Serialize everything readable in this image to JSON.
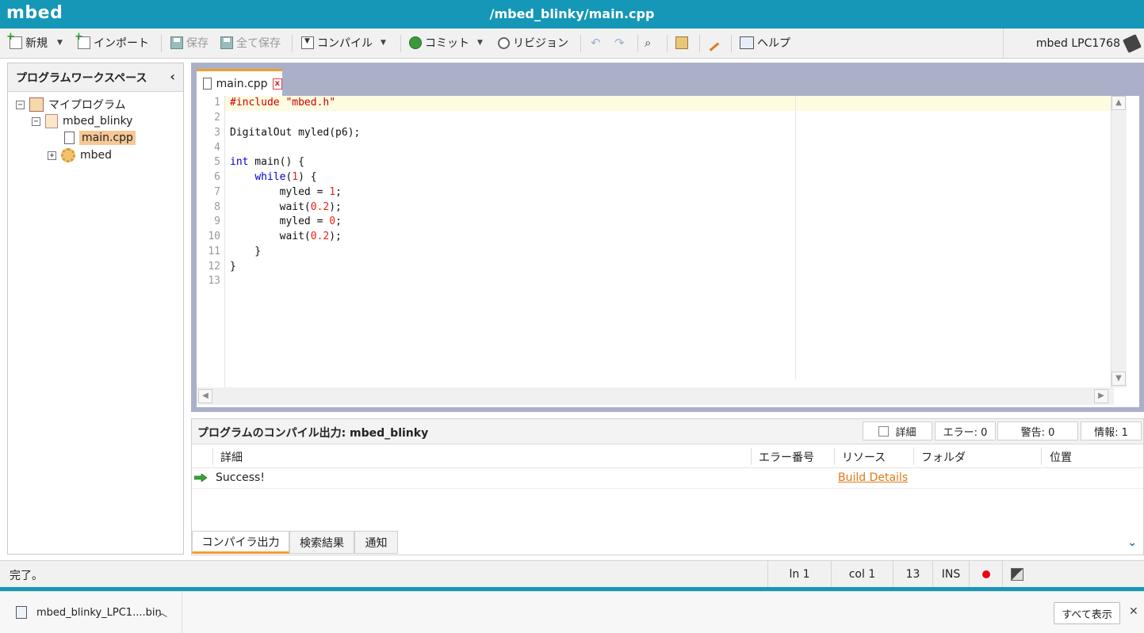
{
  "app": {
    "logo": "mbed",
    "title": "/mbed_blinky/main.cpp"
  },
  "toolbar": {
    "new_label": "新規",
    "import_label": "インポート",
    "save_label": "保存",
    "save_all_label": "全て保存",
    "compile_label": "コンパイル",
    "commit_label": "コミット",
    "revision_label": "リビジョン",
    "help_label": "ヘルプ",
    "device": "mbed LPC1768"
  },
  "workspace": {
    "title": "プログラムワークスペース",
    "collapse_icon": "chevron-left-icon",
    "tree": {
      "root": "マイプログラム",
      "program": "mbed_blinky",
      "file": "main.cpp",
      "library": "mbed"
    }
  },
  "editor": {
    "tab_label": "main.cpp",
    "tab_close": "x",
    "lines": [
      {
        "n": "1"
      },
      {
        "n": "2"
      },
      {
        "n": "3"
      },
      {
        "n": "4"
      },
      {
        "n": "5"
      },
      {
        "n": "6"
      },
      {
        "n": "7"
      },
      {
        "n": "8"
      },
      {
        "n": "9"
      },
      {
        "n": "10"
      },
      {
        "n": "11"
      },
      {
        "n": "12"
      },
      {
        "n": "13"
      }
    ],
    "code": {
      "l1a": "#include ",
      "l1b": "\"mbed.h\"",
      "l3": "DigitalOut myled(p6);",
      "l5a": "int",
      "l5b": " main() {",
      "l6a": "    ",
      "l6b": "while",
      "l6c": "(",
      "l6d": "1",
      "l6e": ") {",
      "l7a": "        myled = ",
      "l7b": "1",
      "l7c": ";",
      "l8a": "        wait(",
      "l8b": "0.2",
      "l8c": ");",
      "l9a": "        myled = ",
      "l9b": "0",
      "l9c": ";",
      "l10a": "        wait(",
      "l10b": "0.2",
      "l10c": ");",
      "l11": "    }",
      "l12": "}"
    }
  },
  "output": {
    "title": "プログラムのコンパイル出力: mbed_blinky",
    "detail_toggle": "詳細",
    "errors": "エラー: 0",
    "warnings": "警告: 0",
    "info": "情報: 1",
    "columns": [
      "詳細",
      "エラー番号",
      "リソース",
      "フォルダ",
      "位置"
    ],
    "rows": [
      {
        "detail": "Success!",
        "error_no": "",
        "resource": "Build Details",
        "folder": "",
        "location": ""
      }
    ],
    "tabs": [
      "コンパイラ出力",
      "検索結果",
      "通知"
    ]
  },
  "status": {
    "text": "完了。",
    "line": "ln 1",
    "col": "col 1",
    "count": "13",
    "mode": "INS"
  },
  "download": {
    "filename": "mbed_blinky_LPC1....bin",
    "show_all": "すべて表示",
    "close": "✕"
  }
}
